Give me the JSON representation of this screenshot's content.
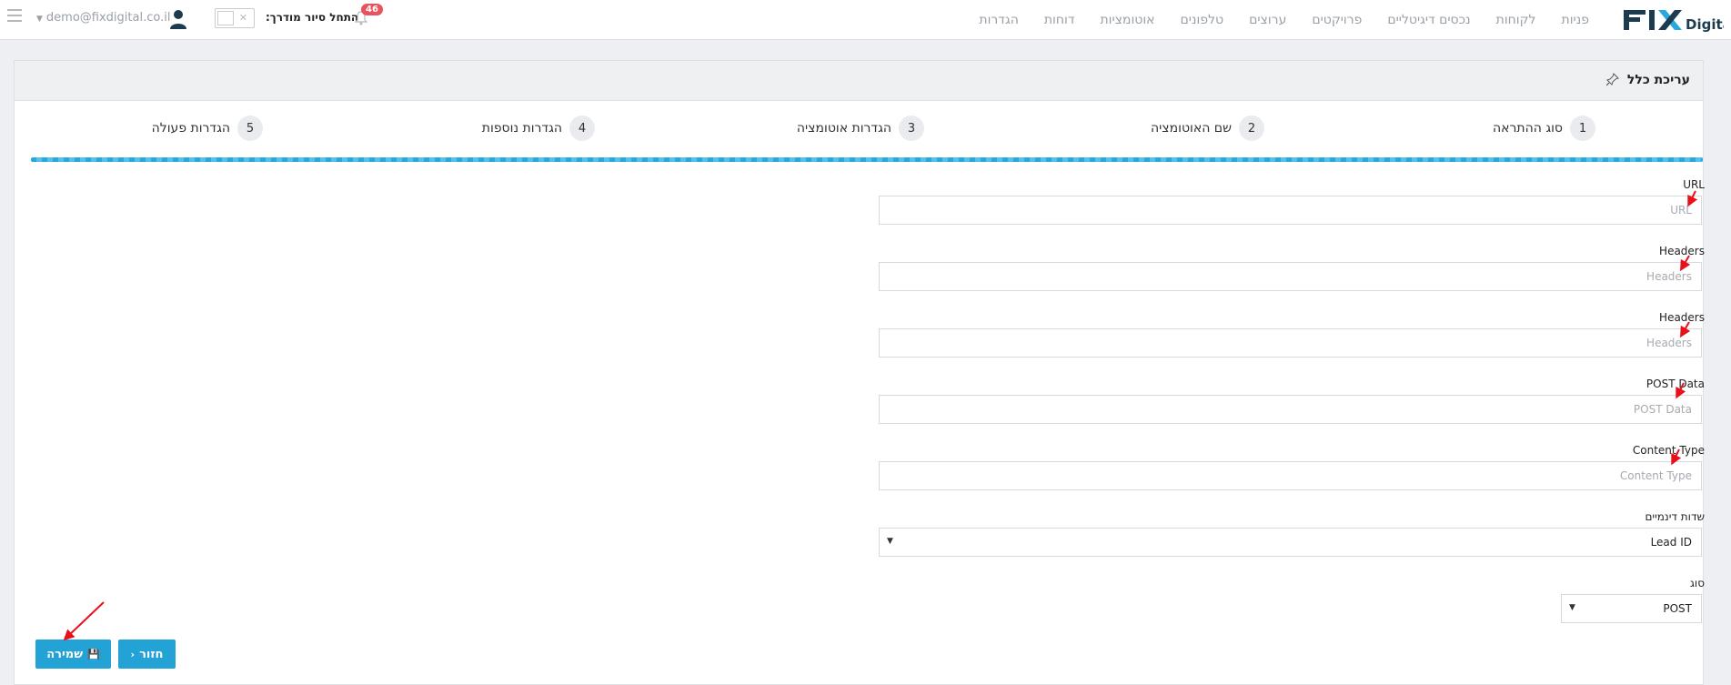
{
  "brand": {
    "logo_text": "FIX",
    "logo_sub": "Digital",
    "colors": {
      "dark": "#1d3b4f",
      "accent": "#29a7df"
    }
  },
  "nav": {
    "items": [
      "פניות",
      "לקוחות",
      "נכסים דיגיטליים",
      "פרויקטים",
      "ערוצים",
      "טלפונים",
      "אוטומציות",
      "דוחות",
      "הגדרות"
    ]
  },
  "user": {
    "email": "demo@fixdigital.co.il",
    "tour_label": "התחל סיור מודרך:",
    "notifications": "46"
  },
  "panel": {
    "title": "עריכת כלל"
  },
  "steps": [
    {
      "num": "1",
      "label": "סוג ההתראה"
    },
    {
      "num": "2",
      "label": "שם האוטומציה"
    },
    {
      "num": "3",
      "label": "הגדרות אוטומציה"
    },
    {
      "num": "4",
      "label": "הגדרות נוספות"
    },
    {
      "num": "5",
      "label": "הגדרות פעולה"
    }
  ],
  "form": {
    "url": {
      "label": "URL",
      "placeholder": "URL"
    },
    "headers1": {
      "label": "Headers",
      "placeholder": "Headers"
    },
    "headers2": {
      "label": "Headers",
      "placeholder": "Headers"
    },
    "post_data": {
      "label": "POST Data",
      "placeholder": "POST Data"
    },
    "content_type": {
      "label": "Content Type",
      "placeholder": "Content Type"
    },
    "dynamic_fields": {
      "label": "שדות דינמיים",
      "value": "Lead ID"
    },
    "type": {
      "label": "סוג",
      "value": "POST"
    }
  },
  "buttons": {
    "save": "שמירה",
    "back": "חזור"
  }
}
